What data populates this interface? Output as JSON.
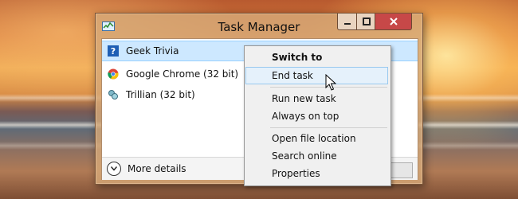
{
  "window": {
    "title": "Task Manager",
    "title_buttons": [
      "minimize-icon",
      "maximize-icon",
      "close-icon"
    ]
  },
  "processes": [
    {
      "name": "Geek Trivia",
      "icon": "question-icon",
      "selected": true
    },
    {
      "name": "Google Chrome (32 bit)",
      "icon": "chrome-icon",
      "selected": false
    },
    {
      "name": "Trillian (32 bit)",
      "icon": "trillian-icon",
      "selected": false
    }
  ],
  "footer": {
    "more_details": "More details",
    "more_details_icon": "chevron-down-icon"
  },
  "context_menu": {
    "groups": [
      [
        {
          "label": "Switch to",
          "bold": true
        },
        {
          "label": "End task",
          "highlighted": true
        }
      ],
      [
        {
          "label": "Run new task"
        },
        {
          "label": "Always on top"
        }
      ],
      [
        {
          "label": "Open file location"
        },
        {
          "label": "Search online"
        },
        {
          "label": "Properties"
        }
      ]
    ]
  },
  "colors": {
    "selection": "#cde8ff",
    "menu_highlight": "#e5f1fb",
    "close_button": "#c74848"
  }
}
